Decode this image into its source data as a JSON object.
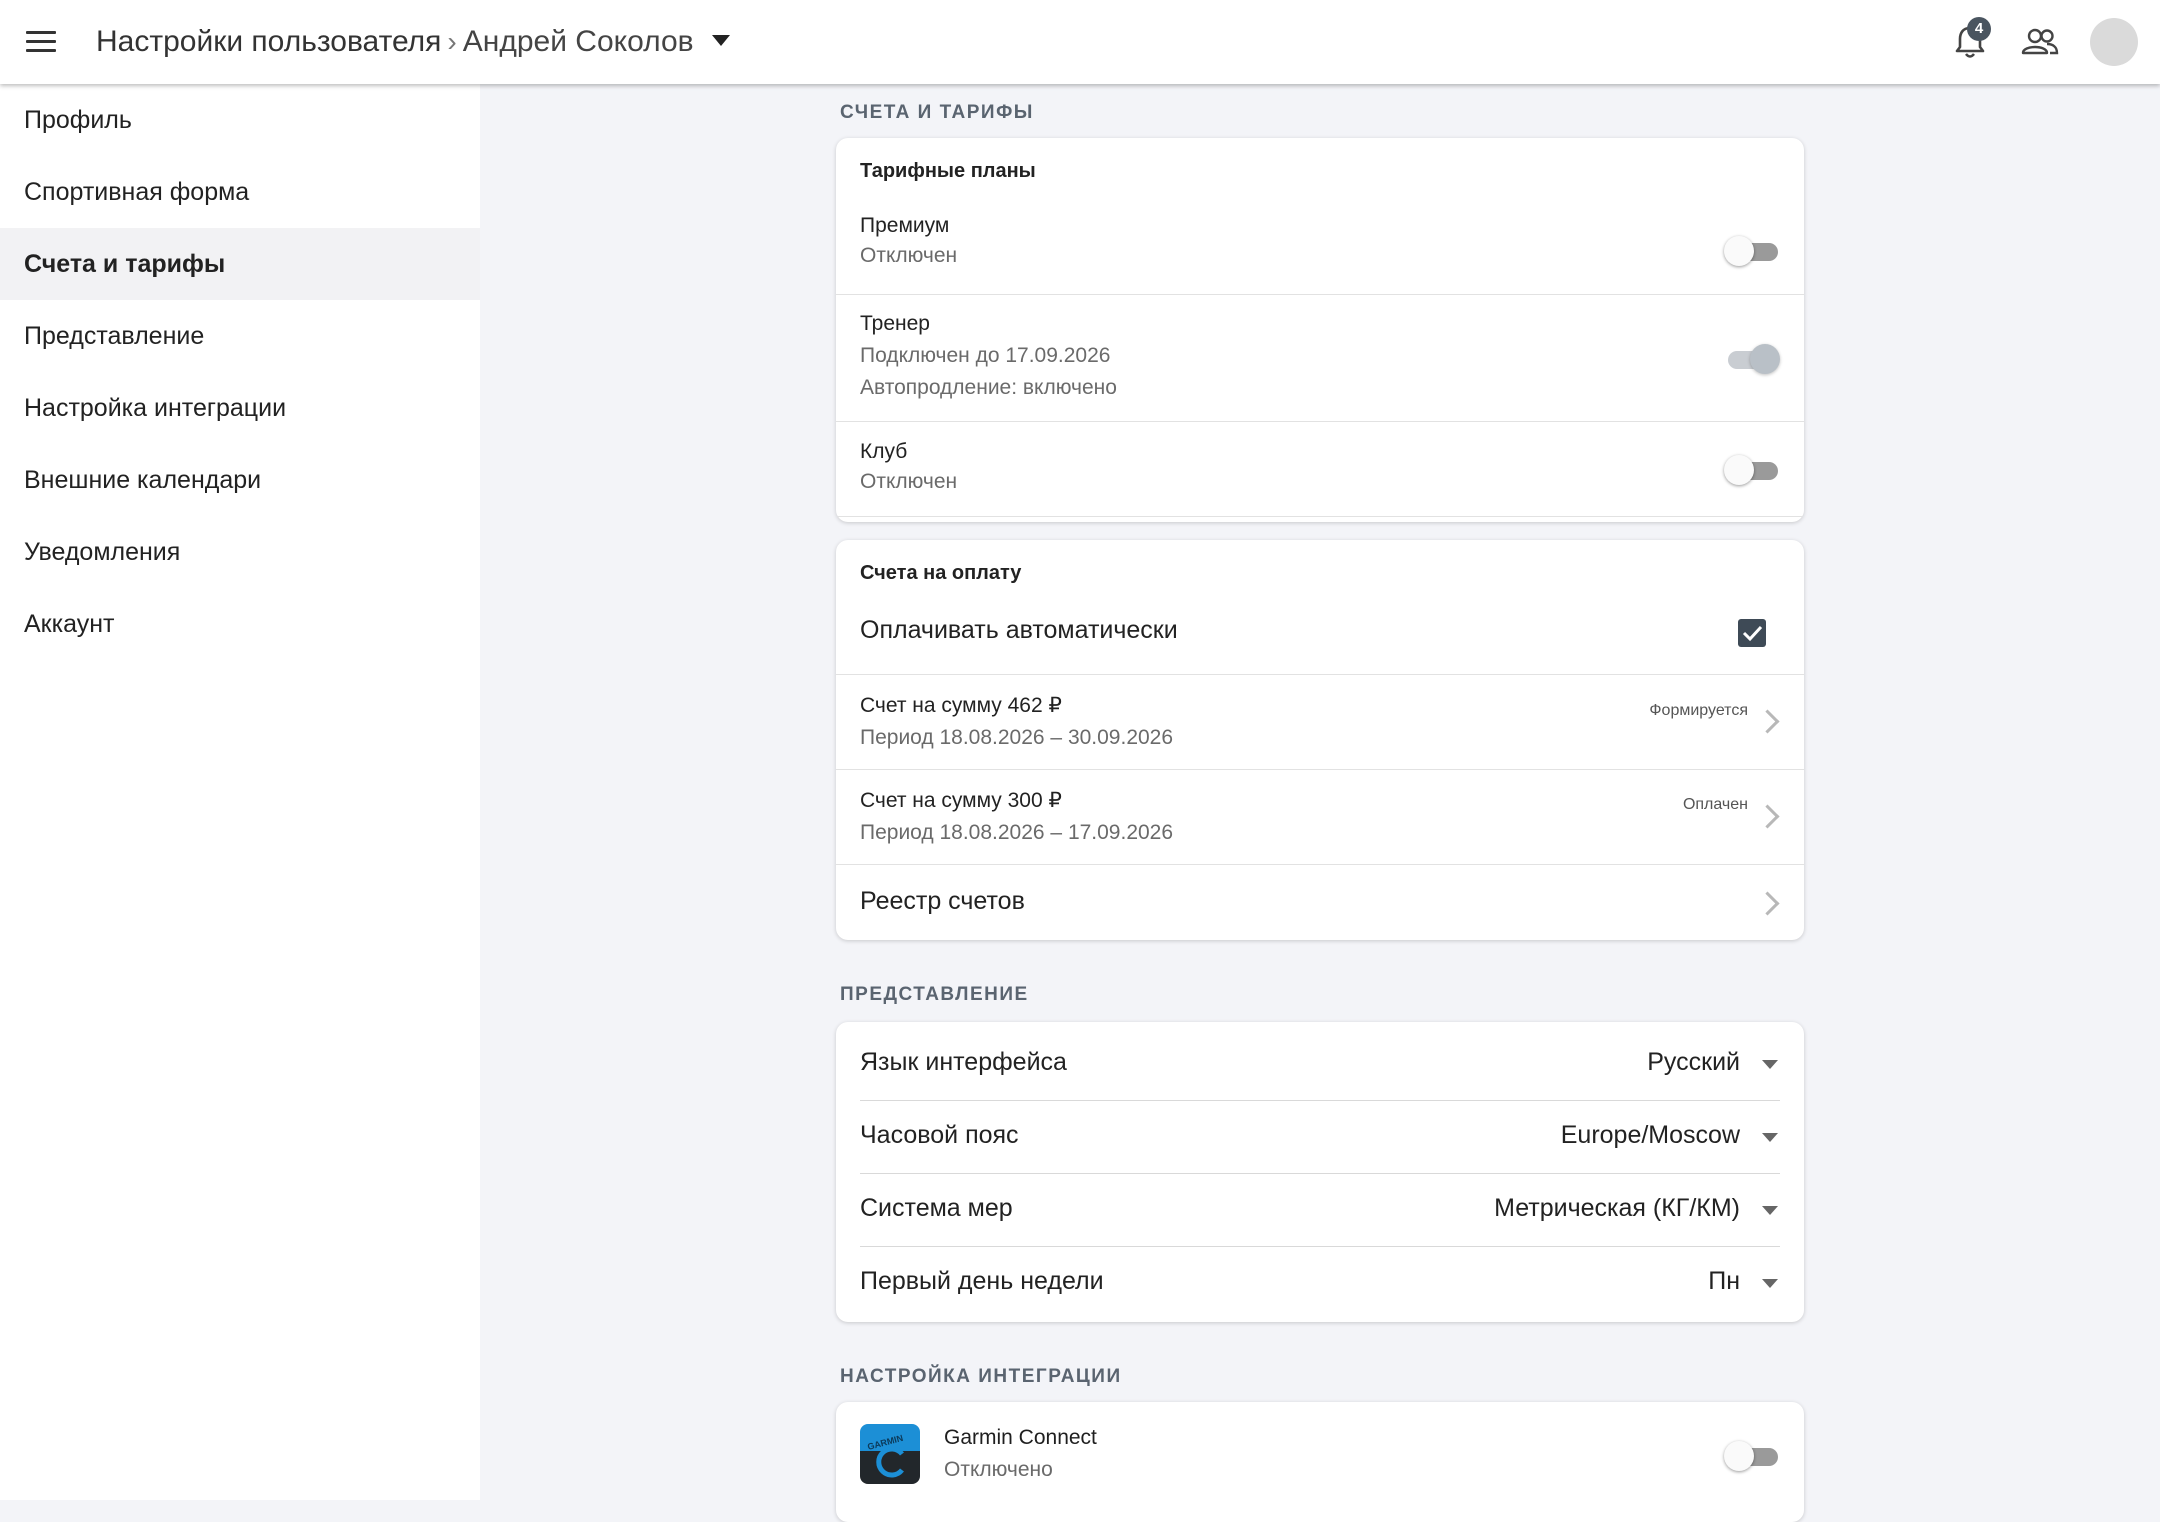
{
  "header": {
    "title": "Настройки пользователя",
    "separator": "›",
    "user_name": "Андрей Соколов",
    "notifications_count": "4"
  },
  "sidebar": {
    "items": [
      {
        "label": "Профиль"
      },
      {
        "label": "Спортивная форма"
      },
      {
        "label": "Счета и тарифы",
        "active": true
      },
      {
        "label": "Представление"
      },
      {
        "label": "Настройка интеграции"
      },
      {
        "label": "Внешние календари"
      },
      {
        "label": "Уведомления"
      },
      {
        "label": "Аккаунт"
      }
    ]
  },
  "billing": {
    "section_title": "СЧЕТА И ТАРИФЫ",
    "plans": {
      "title": "Тарифные планы",
      "items": [
        {
          "name": "Премиум",
          "status": "Отключен",
          "enabled": false
        },
        {
          "name": "Тренер",
          "status": "Подключен до 17.09.2026",
          "extra": "Автопродление: включено",
          "enabled": true
        },
        {
          "name": "Клуб",
          "status": "Отключен",
          "enabled": false
        }
      ]
    },
    "invoices": {
      "title": "Счета на оплату",
      "autopay_label": "Оплачивать автоматически",
      "autopay_checked": true,
      "items": [
        {
          "title": "Счет на сумму 462 ₽",
          "period": "Период 18.08.2026 – 30.09.2026",
          "status": "Формируется"
        },
        {
          "title": "Счет на сумму 300 ₽",
          "period": "Период 18.08.2026 – 17.09.2026",
          "status": "Оплачен"
        }
      ],
      "registry_label": "Реестр счетов"
    }
  },
  "view": {
    "section_title": "ПРЕДСТАВЛЕНИЕ",
    "rows": [
      {
        "label": "Язык интерфейса",
        "value": "Русский"
      },
      {
        "label": "Часовой пояс",
        "value": "Europe/Moscow"
      },
      {
        "label": "Система мер",
        "value": "Метрическая (КГ/КМ)"
      },
      {
        "label": "Первый день недели",
        "value": "Пн"
      }
    ]
  },
  "integration": {
    "section_title": "НАСТРОЙКА ИНТЕГРАЦИИ",
    "garmin": {
      "name": "Garmin Connect",
      "status": "Отключено",
      "logo_text": "GARMIN",
      "enabled": false
    }
  },
  "colors": {
    "background": "#f3f4f8",
    "checkbox": "#3e4a56",
    "badge": "#4a5560",
    "garmin_blue": "#1c8fd6"
  }
}
